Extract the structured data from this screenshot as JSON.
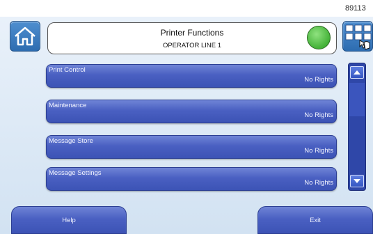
{
  "screen_id": "89113",
  "header": {
    "title": "Printer Functions",
    "subtitle": "OPERATOR LINE 1",
    "status_color": "#44b238"
  },
  "icons": {
    "home": "home-icon",
    "menu": "grid-menu-icon"
  },
  "menu_items": [
    {
      "label": "Print Control",
      "value": "No Rights"
    },
    {
      "label": "Maintenance",
      "value": "No Rights"
    },
    {
      "label": "Message Store",
      "value": "No Rights"
    },
    {
      "label": "Message Settings",
      "value": "No Rights"
    }
  ],
  "footer": {
    "help_label": "Help",
    "exit_label": "Exit"
  },
  "colors": {
    "button_blue": "#4a60c2",
    "scrollbar": "#2f47a8",
    "background": "#dbe8f5"
  }
}
